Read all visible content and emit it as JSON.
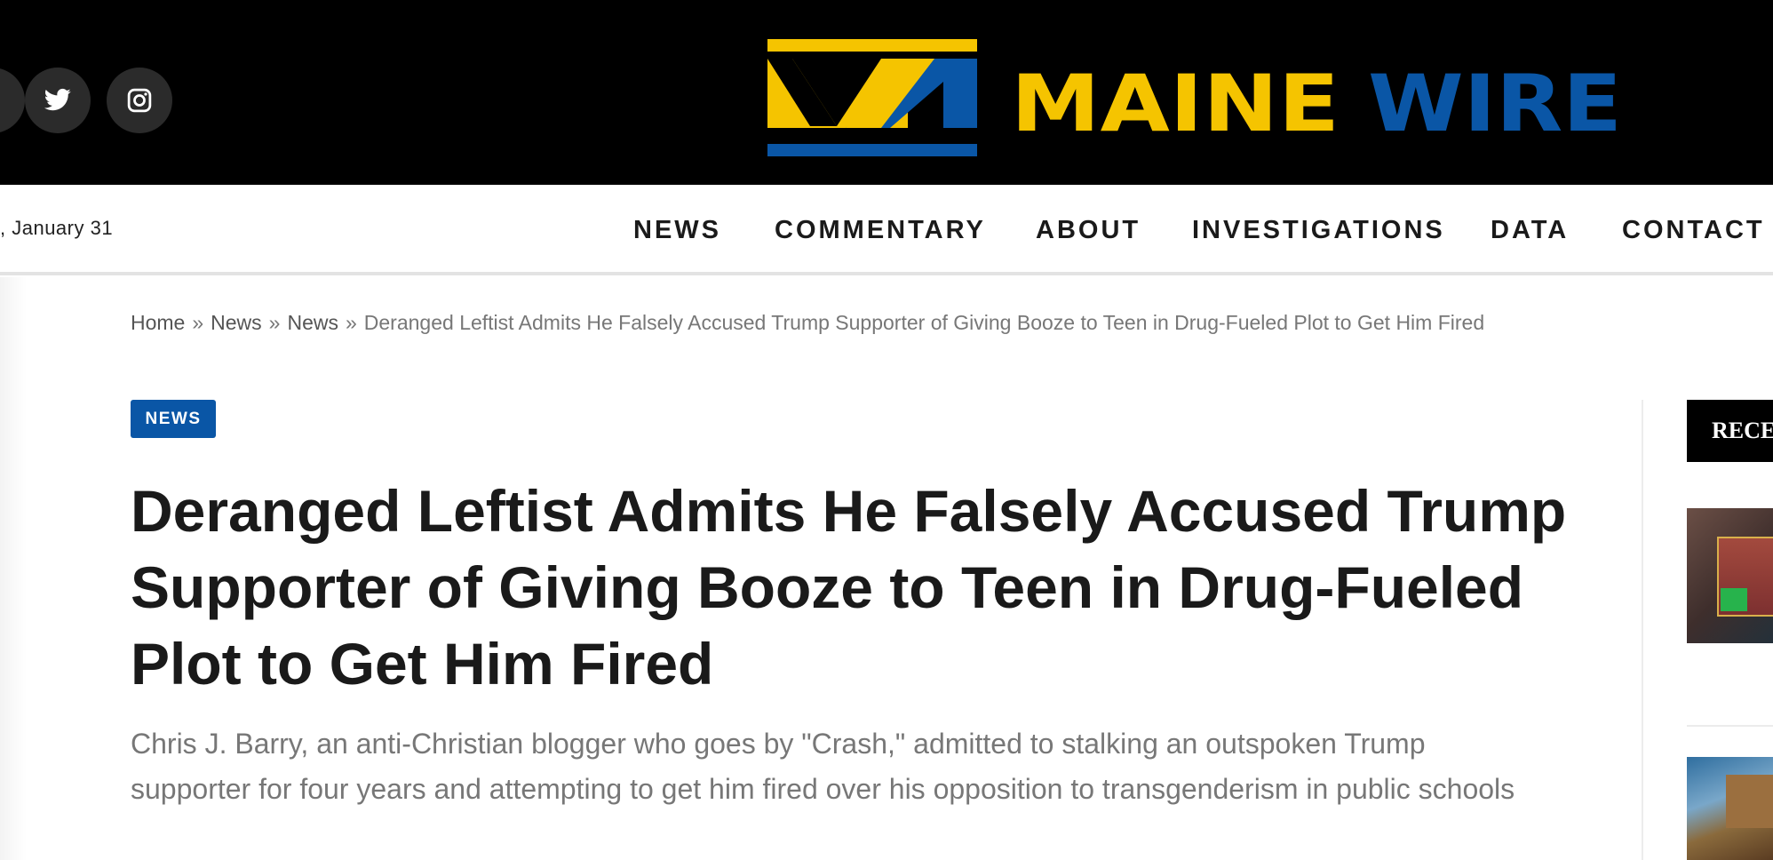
{
  "header": {
    "brand": {
      "part1": "MAINE",
      "part2": "WIRE"
    },
    "social_icons": [
      "facebook-icon",
      "twitter-icon",
      "instagram-icon"
    ]
  },
  "nav": {
    "date": ", January 31",
    "items": [
      "NEWS",
      "COMMENTARY",
      "ABOUT",
      "INVESTIGATIONS",
      "DATA",
      "CONTACT"
    ]
  },
  "breadcrumb": {
    "home": "Home",
    "section1": "News",
    "section2": "News",
    "separator": "»",
    "current": "Deranged Leftist Admits He Falsely Accused Trump Supporter of Giving Booze to Teen in Drug-Fueled Plot to Get Him Fired"
  },
  "article": {
    "category": "NEWS",
    "title": "Deranged Leftist Admits He Falsely Accused Trump Supporter of Giving Booze to Teen in Drug-Fueled Plot to Get Him Fired",
    "subtitle": "Chris J. Barry, an anti-Christian blogger who goes by \"Crash,\" admitted to stalking an outspoken Trump supporter for four years and attempting to get him fired over his opposition to transgenderism in public schools"
  },
  "sidebar": {
    "heading": "RECE"
  },
  "colors": {
    "brand_yellow": "#f5c400",
    "brand_blue": "#0a56a6",
    "header_bg": "#000000",
    "badge_bg": "#0a56a6"
  }
}
